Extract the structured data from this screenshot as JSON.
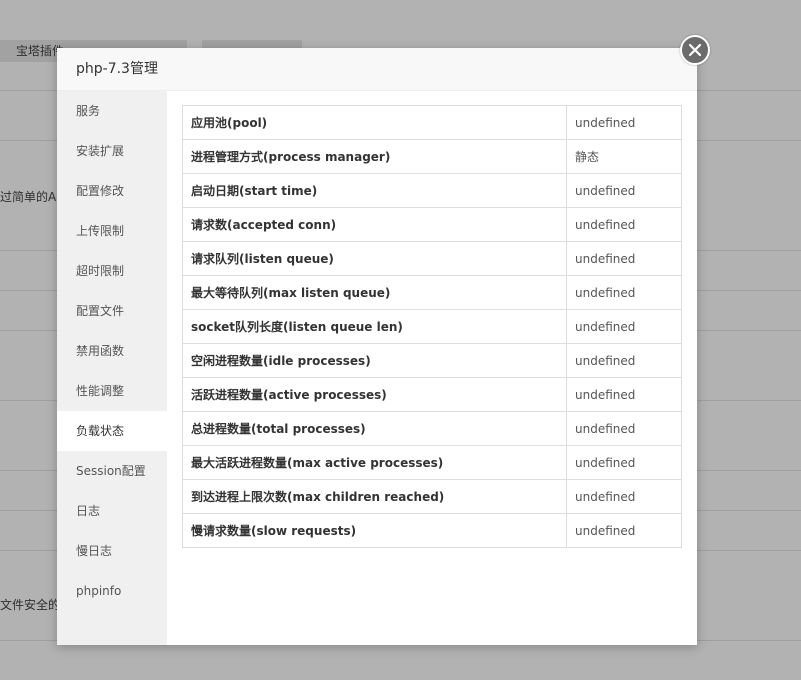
{
  "background": {
    "tab_label": "宝塔插件",
    "text_line_1": "过简单的API",
    "text_line_2": "文件安全的免"
  },
  "modal": {
    "title": "php-7.3管理",
    "close_icon": "close-icon"
  },
  "side_menu": {
    "items": [
      {
        "label": "服务"
      },
      {
        "label": "安装扩展"
      },
      {
        "label": "配置修改"
      },
      {
        "label": "上传限制"
      },
      {
        "label": "超时限制"
      },
      {
        "label": "配置文件"
      },
      {
        "label": "禁用函数"
      },
      {
        "label": "性能调整"
      },
      {
        "label": "负载状态",
        "active": true
      },
      {
        "label": "Session配置"
      },
      {
        "label": "日志"
      },
      {
        "label": "慢日志"
      },
      {
        "label": "phpinfo"
      }
    ]
  },
  "status_table": {
    "rows": [
      {
        "label": "应用池(pool)",
        "value": "undefined"
      },
      {
        "label": "进程管理方式(process manager)",
        "value": "静态"
      },
      {
        "label": "启动日期(start time)",
        "value": "undefined"
      },
      {
        "label": "请求数(accepted conn)",
        "value": "undefined"
      },
      {
        "label": "请求队列(listen queue)",
        "value": "undefined"
      },
      {
        "label": "最大等待队列(max listen queue)",
        "value": "undefined"
      },
      {
        "label": "socket队列长度(listen queue len)",
        "value": "undefined"
      },
      {
        "label": "空闲进程数量(idle processes)",
        "value": "undefined"
      },
      {
        "label": "活跃进程数量(active processes)",
        "value": "undefined"
      },
      {
        "label": "总进程数量(total processes)",
        "value": "undefined"
      },
      {
        "label": "最大活跃进程数量(max active processes)",
        "value": "undefined"
      },
      {
        "label": "到达进程上限次数(max children reached)",
        "value": "undefined"
      },
      {
        "label": "慢请求数量(slow requests)",
        "value": "undefined"
      }
    ]
  }
}
